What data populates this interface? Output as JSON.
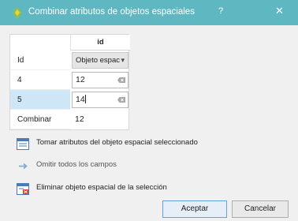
{
  "window": {
    "title": "Combinar atributos de objetos espaciales",
    "help_label": "?",
    "close_label": "✕"
  },
  "grid": {
    "column_header": "id",
    "field_row_label": "Id",
    "strategy_value": "Objeto espac",
    "rows": [
      {
        "label": "4",
        "value": "12"
      },
      {
        "label": "5",
        "value": "14"
      }
    ],
    "combine_label": "Combinar",
    "combine_value": "12"
  },
  "actions": {
    "take_attributes": "Tomar atributos del objeto espacial seleccionado",
    "skip_all": "Omitir todos los campos",
    "remove_feature": "Eliminar objeto espacial de la selección"
  },
  "buttons": {
    "accept": "Aceptar",
    "cancel": "Cancelar"
  },
  "colors": {
    "titlebar": "#5fb8c1",
    "selected_row": "#cfe6f7"
  }
}
